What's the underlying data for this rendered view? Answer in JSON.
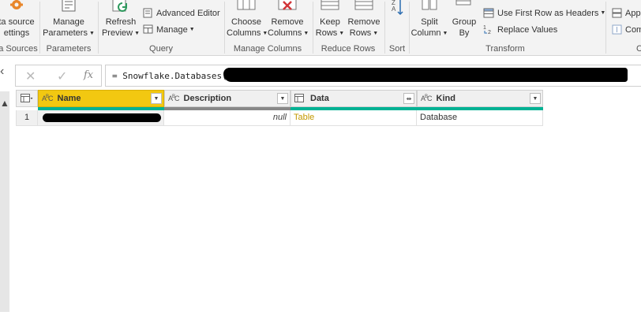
{
  "ribbon": {
    "data_source_settings": {
      "line1": "ta source",
      "line2": "ettings"
    },
    "manage_parameters": {
      "line1": "Manage",
      "line2": "Parameters"
    },
    "refresh_preview": {
      "line1": "Refresh",
      "line2": "Preview"
    },
    "advanced_editor": "Advanced Editor",
    "manage": "Manage",
    "choose_columns": {
      "line1": "Choose",
      "line2": "Columns"
    },
    "remove_columns": {
      "line1": "Remove",
      "line2": "Columns"
    },
    "keep_rows": {
      "line1": "Keep",
      "line2": "Rows"
    },
    "remove_rows": {
      "line1": "Remove",
      "line2": "Rows"
    },
    "split_column": {
      "line1": "Split",
      "line2": "Column"
    },
    "group_by": {
      "line1": "Group",
      "line2": "By"
    },
    "use_first_row": "Use First Row as Headers",
    "replace_values": "Replace Values",
    "append": "App",
    "combine": "Com",
    "groups": {
      "data_sources": "a Sources",
      "parameters": "Parameters",
      "query": "Query",
      "manage_columns": "Manage Columns",
      "reduce_rows": "Reduce Rows",
      "sort": "Sort",
      "transform": "Transform",
      "combine": "C"
    }
  },
  "formula_bar": {
    "cancel_glyph": "✕",
    "commit_glyph": "✓",
    "fx_glyph": "fx",
    "formula": "= Snowflake.Databases("
  },
  "grid": {
    "columns": [
      {
        "name": "Name",
        "type_glyph": "ABC",
        "selected": true
      },
      {
        "name": "Description",
        "type_glyph": "ABC",
        "selected": false
      },
      {
        "name": "Data",
        "type_glyph": "table",
        "selected": false
      },
      {
        "name": "Kind",
        "type_glyph": "ABC",
        "selected": false
      }
    ],
    "rows": [
      {
        "index": "1",
        "description": "null",
        "data": "Table",
        "kind": "Database"
      }
    ]
  },
  "colors": {
    "selected_header": "#f2c811",
    "quality_green": "#00b294",
    "quality_gray": "#888888",
    "table_link": "#c39900"
  }
}
